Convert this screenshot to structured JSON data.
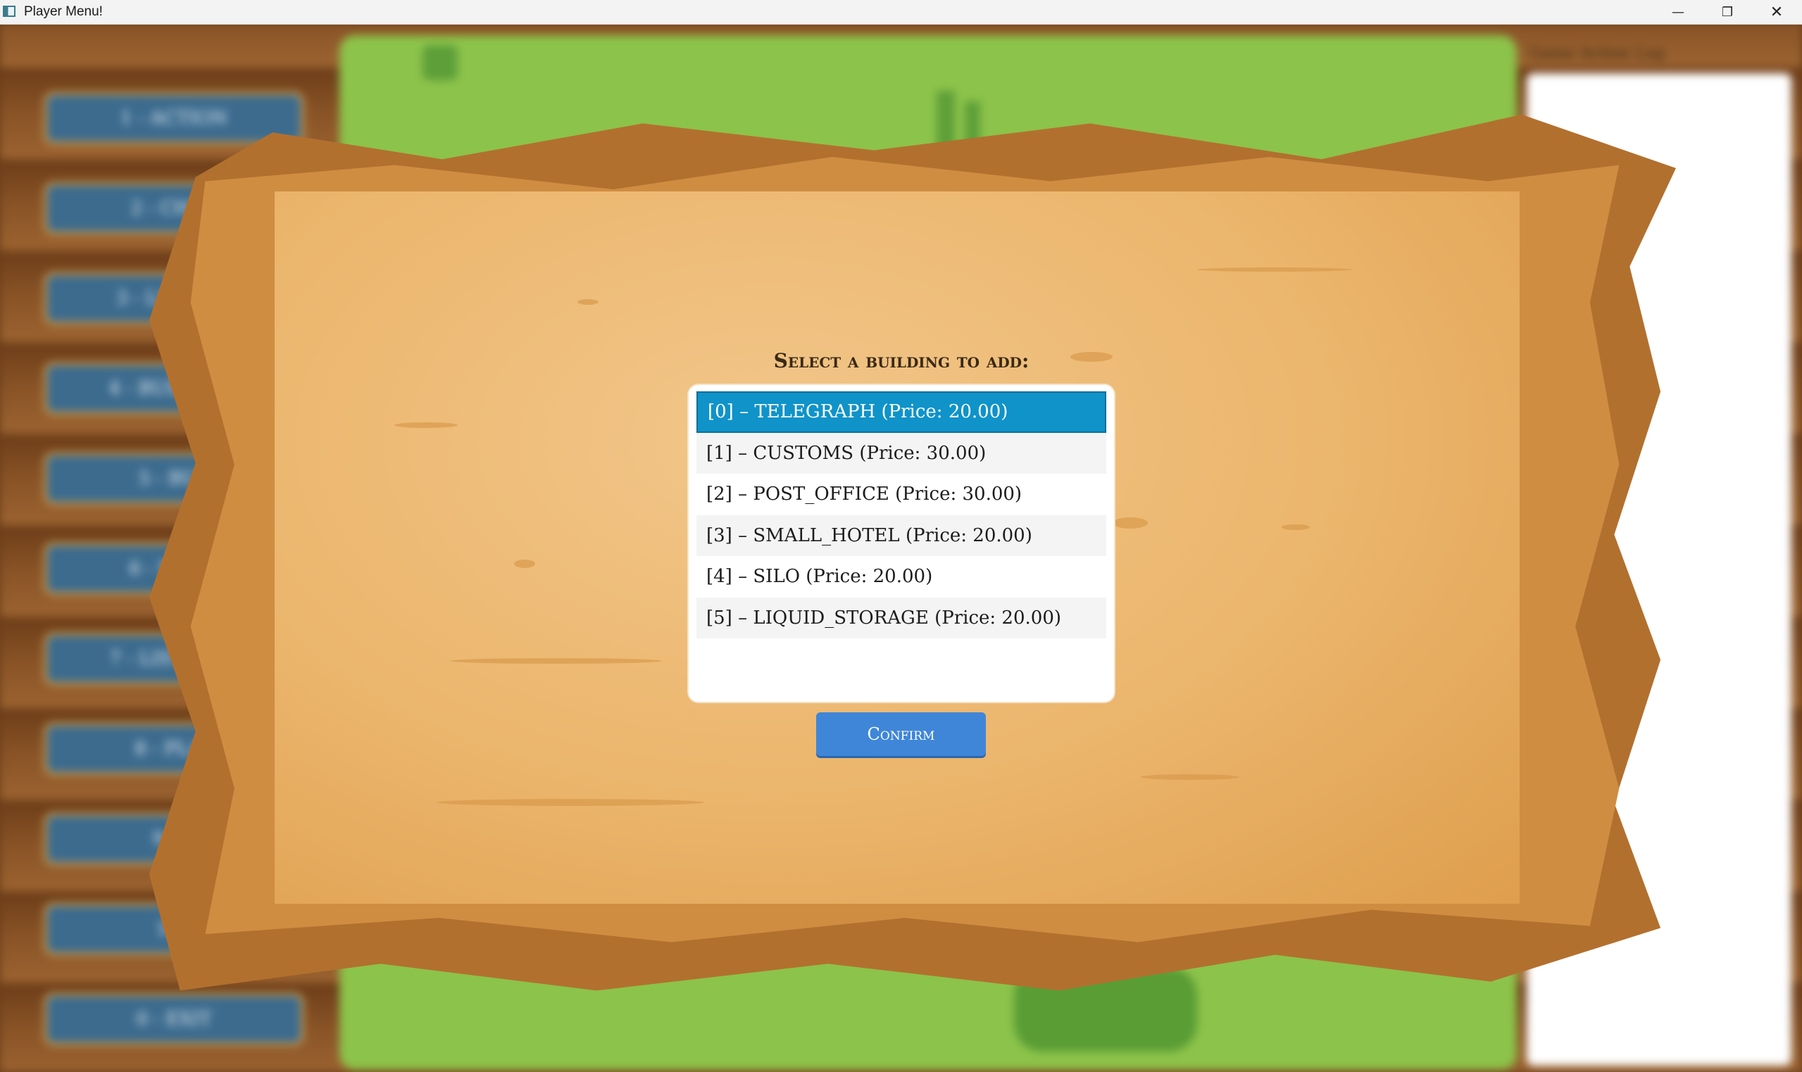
{
  "window": {
    "title": "Player Menu!",
    "controls": {
      "minimize": "—",
      "maximize": "❐",
      "close": "✕"
    }
  },
  "background": {
    "log_title": "Game Action Log",
    "side_buttons": [
      "1 - ACTION",
      "2 - CHAR",
      "3 - LIST BUI",
      "4 - BUILDING",
      "5 - BUY",
      "6 - MOVE",
      "7 - LIST PLAY",
      "8 - PLAY",
      "9 - E",
      "10 -",
      "0 - EXIT"
    ]
  },
  "dialog": {
    "title": "Select a building to add:",
    "items": [
      "[0] – TELEGRAPH (Price: 20.00)",
      "[1] – CUSTOMS (Price: 30.00)",
      "[2] – POST_OFFICE (Price: 30.00)",
      "[3] – SMALL_HOTEL (Price: 20.00)",
      "[4] – SILO (Price: 20.00)",
      "[5] – LIQUID_STORAGE (Price: 20.00)"
    ],
    "selected_index": 0,
    "confirm_label": "Confirm"
  },
  "colors": {
    "selection": "#0f93c9",
    "confirm_button": "#3f86d8",
    "board": "#ebb56c"
  }
}
